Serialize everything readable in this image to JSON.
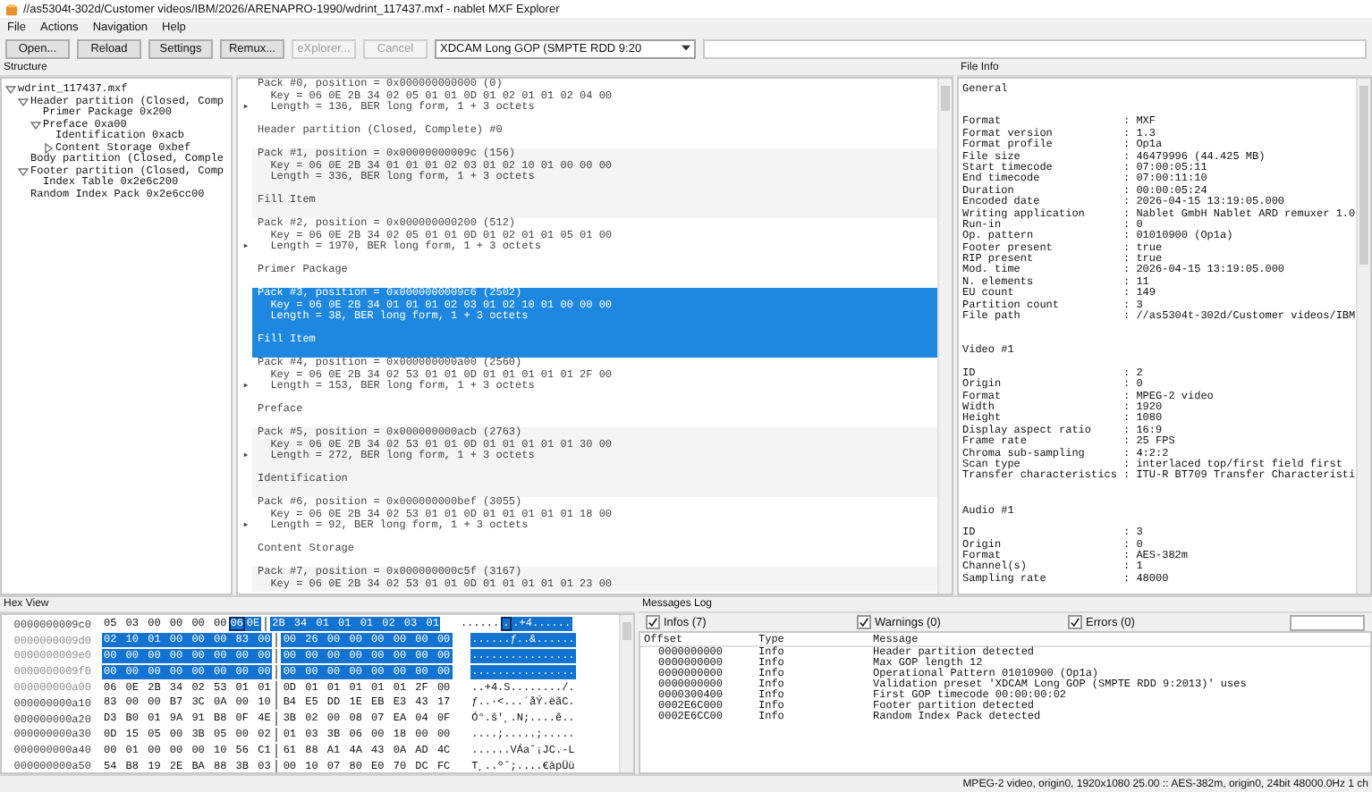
{
  "window": {
    "title": "//as5304t-302d/Customer videos/IBM/2026/ARENAPRO-1990/wdrint_117437.mxf - nablet MXF Explorer"
  },
  "menu": [
    "File",
    "Actions",
    "Navigation",
    "Help"
  ],
  "toolbar": {
    "buttons": [
      {
        "label": "Open...",
        "disabled": false
      },
      {
        "label": "Reload",
        "disabled": false
      },
      {
        "label": "Settings",
        "disabled": false
      },
      {
        "label": "Remux...",
        "disabled": false
      },
      {
        "label": "eXplorer...",
        "disabled": true
      },
      {
        "label": "Cancel",
        "disabled": true
      }
    ],
    "preset": "XDCAM Long GOP (SMPTE RDD 9:20"
  },
  "structure": {
    "title": "Structure",
    "tree": [
      {
        "label": "wdrint_117437.mxf",
        "expanded": true,
        "children": [
          {
            "label": "Header partition (Closed, Comp",
            "expanded": true,
            "children": [
              {
                "label": "Primer Package 0x200"
              },
              {
                "label": "Preface 0xa00",
                "expanded": true,
                "children": [
                  {
                    "label": "Identification 0xacb"
                  },
                  {
                    "label": "Content Storage 0xbef",
                    "expanded": false
                  }
                ]
              }
            ]
          },
          {
            "label": "Body partition (Closed, Comple"
          },
          {
            "label": "Footer partition (Closed, Comp",
            "expanded": true,
            "children": [
              {
                "label": "Index Table 0x2e6c200"
              }
            ]
          },
          {
            "label": "Random Index Pack 0x2e6cc00"
          }
        ]
      }
    ]
  },
  "packets": [
    {
      "lines": [
        "Pack #0, position = 0x000000000000 (0)",
        "  Key = 06 0E 2B 34 02 05 01 01 0D 01 02 01 01 02 04 00",
        "  Length = 136, BER long form, 1 + 3 octets"
      ],
      "name": "Header partition (Closed, Complete) #0",
      "expandable": true,
      "selected": false
    },
    {
      "lines": [
        "Pack #1, position = 0x00000000009c (156)",
        "  Key = 06 0E 2B 34 01 01 01 02 03 01 02 10 01 00 00 00",
        "  Length = 336, BER long form, 1 + 3 octets"
      ],
      "name": "Fill Item",
      "expandable": false,
      "selected": false
    },
    {
      "lines": [
        "Pack #2, position = 0x000000000200 (512)",
        "  Key = 06 0E 2B 34 02 05 01 01 0D 01 02 01 01 05 01 00",
        "  Length = 1970, BER long form, 1 + 3 octets"
      ],
      "name": "Primer Package",
      "expandable": true,
      "selected": false
    },
    {
      "lines": [
        "Pack #3, position = 0x0000000009c6 (2502)",
        "  Key = 06 0E 2B 34 01 01 01 02 03 01 02 10 01 00 00 00",
        "  Length = 38, BER long form, 1 + 3 octets"
      ],
      "name": "Fill Item",
      "expandable": false,
      "selected": true
    },
    {
      "lines": [
        "Pack #4, position = 0x000000000a00 (2560)",
        "  Key = 06 0E 2B 34 02 53 01 01 0D 01 01 01 01 01 2F 00",
        "  Length = 153, BER long form, 1 + 3 octets"
      ],
      "name": "Preface",
      "expandable": true,
      "selected": false
    },
    {
      "lines": [
        "Pack #5, position = 0x000000000acb (2763)",
        "  Key = 06 0E 2B 34 02 53 01 01 0D 01 01 01 01 01 30 00",
        "  Length = 272, BER long form, 1 + 3 octets"
      ],
      "name": "Identification",
      "expandable": true,
      "selected": false
    },
    {
      "lines": [
        "Pack #6, position = 0x000000000bef (3055)",
        "  Key = 06 0E 2B 34 02 53 01 01 0D 01 01 01 01 01 18 00",
        "  Length = 92, BER long form, 1 + 3 octets"
      ],
      "name": "Content Storage",
      "expandable": true,
      "selected": false
    },
    {
      "lines": [
        "Pack #7, position = 0x000000000c5f (3167)",
        "  Key = 06 0E 2B 34 02 53 01 01 0D 01 01 01 01 01 23 00"
      ],
      "expandable": false,
      "selected": false
    }
  ],
  "file_info": {
    "title": "File Info",
    "sections": [
      {
        "heading": "General",
        "rows": [
          {
            "key": "Format",
            "value": ": MXF"
          },
          {
            "key": "Format version",
            "value": ": 1.3"
          },
          {
            "key": "Format profile",
            "value": ": Op1a"
          },
          {
            "key": "File size",
            "value": ": 46479996 (44.425 MB)"
          },
          {
            "key": "Start timecode",
            "value": ": 07:00:05:11"
          },
          {
            "key": "End timecode",
            "value": ": 07:00:11:10"
          },
          {
            "key": "Duration",
            "value": ": 00:00:05:24"
          },
          {
            "key": "Encoded date",
            "value": ": 2026-04-15 13:19:05.000"
          },
          {
            "key": "Writing application",
            "value": ": Nablet GmbH Nablet ARD remuxer 1.0"
          },
          {
            "key": "Run-in",
            "value": ": 0"
          },
          {
            "key": "Op. pattern",
            "value": ": 01010900 (Op1a)"
          },
          {
            "key": "Footer present",
            "value": ": true"
          },
          {
            "key": "RIP present",
            "value": ": true"
          },
          {
            "key": "Mod. time",
            "value": ": 2026-04-15 13:19:05.000"
          },
          {
            "key": "N. elements",
            "value": ": 11"
          },
          {
            "key": "EU count",
            "value": ": 149"
          },
          {
            "key": "Partition count",
            "value": ": 3"
          },
          {
            "key": "File path",
            "value": ": //as5304t-302d/Customer videos/IBM"
          }
        ]
      },
      {
        "heading": "Video #1",
        "rows": [
          {
            "key": "ID",
            "value": ": 2"
          },
          {
            "key": "Origin",
            "value": ": 0"
          },
          {
            "key": "Format",
            "value": ": MPEG-2 video"
          },
          {
            "key": "Width",
            "value": ": 1920"
          },
          {
            "key": "Height",
            "value": ": 1080"
          },
          {
            "key": "Display aspect ratio",
            "value": ": 16:9"
          },
          {
            "key": "Frame rate",
            "value": ": 25 FPS"
          },
          {
            "key": "Chroma sub-sampling",
            "value": ": 4:2:2"
          },
          {
            "key": "Scan type",
            "value": ": interlaced top/first field first"
          },
          {
            "key": "Transfer characteristics",
            "value": ": ITU-R BT709 Transfer Characteristi"
          }
        ]
      },
      {
        "heading": "Audio #1",
        "rows": [
          {
            "key": "ID",
            "value": ": 3"
          },
          {
            "key": "Origin",
            "value": ": 0"
          },
          {
            "key": "Format",
            "value": ": AES-382m"
          },
          {
            "key": "Channel(s)",
            "value": ": 1"
          },
          {
            "key": "Sampling rate",
            "value": ": 48000"
          }
        ]
      }
    ]
  },
  "hex_view": {
    "title": "Hex View",
    "rows": [
      {
        "offset": "0000000009c0",
        "dim": false,
        "left": [
          {
            "text": "05 03 00 00 00 00",
            "selected": false,
            "cursor": false
          },
          {
            "text": "06",
            "selected": true,
            "cursor": true
          },
          {
            "text": "0E",
            "selected": true,
            "cursor": false
          }
        ],
        "right": [
          {
            "text": "2B 34 01 01 01 02 03 01",
            "selected": true,
            "cursor": false
          }
        ],
        "ascii": [
          {
            "text": "......",
            "selected": false,
            "cursor": false
          },
          {
            "text": ".",
            "selected": true,
            "cursor": true
          },
          {
            "text": ".+4......",
            "selected": true,
            "cursor": false
          }
        ]
      },
      {
        "offset": "0000000009d0",
        "dim": true,
        "left": [
          {
            "text": "02 10 01 00 00 00 83 00",
            "selected": true,
            "cursor": false
          }
        ],
        "right": [
          {
            "text": "00 26 00 00 00 00 00 00",
            "selected": true,
            "cursor": false
          }
        ],
        "ascii": [
          {
            "text": "......ƒ..&......",
            "selected": true,
            "cursor": false
          }
        ]
      },
      {
        "offset": "0000000009e0",
        "dim": true,
        "left": [
          {
            "text": "00 00 00 00 00 00 00 00",
            "selected": true,
            "cursor": false
          }
        ],
        "right": [
          {
            "text": "00 00 00 00 00 00 00 00",
            "selected": true,
            "cursor": false
          }
        ],
        "ascii": [
          {
            "text": "................",
            "selected": true,
            "cursor": false
          }
        ]
      },
      {
        "offset": "0000000009f0",
        "dim": true,
        "left": [
          {
            "text": "00 00 00 00 00 00 00 00",
            "selected": true,
            "cursor": false
          }
        ],
        "right": [
          {
            "text": "00 00 00 00 00 00 00 00",
            "selected": true,
            "cursor": false
          }
        ],
        "ascii": [
          {
            "text": "................",
            "selected": true,
            "cursor": false
          }
        ]
      },
      {
        "offset": "000000000a00",
        "dim": true,
        "left": [
          {
            "text": "06 0E 2B 34 02 53 01 01",
            "selected": false,
            "cursor": false
          }
        ],
        "right": [
          {
            "text": "0D 01 01 01 01 01 2F 00",
            "selected": false,
            "cursor": false
          }
        ],
        "ascii": [
          {
            "text": "..+4.S......../.",
            "selected": false,
            "cursor": false
          }
        ]
      },
      {
        "offset": "000000000a10",
        "dim": false,
        "left": [
          {
            "text": "83 00 00 B7 3C 0A 00 10",
            "selected": false,
            "cursor": false
          }
        ],
        "right": [
          {
            "text": "B4 E5 DD 1E EB E3 43 17",
            "selected": false,
            "cursor": false
          }
        ],
        "ascii": [
          {
            "text": "ƒ..·<...´åÝ.ëãC.",
            "selected": false,
            "cursor": false
          }
        ]
      },
      {
        "offset": "000000000a20",
        "dim": false,
        "left": [
          {
            "text": "D3 B0 01 9A 91 B8 0F 4E",
            "selected": false,
            "cursor": false
          }
        ],
        "right": [
          {
            "text": "3B 02 00 08 07 EA 04 0F",
            "selected": false,
            "cursor": false
          }
        ],
        "ascii": [
          {
            "text": "Ó°.š'¸.N;....ê..",
            "selected": false,
            "cursor": false
          }
        ]
      },
      {
        "offset": "000000000a30",
        "dim": false,
        "left": [
          {
            "text": "0D 15 05 00 3B 05 00 02",
            "selected": false,
            "cursor": false
          }
        ],
        "right": [
          {
            "text": "01 03 3B 06 00 18 00 00",
            "selected": false,
            "cursor": false
          }
        ],
        "ascii": [
          {
            "text": "....;.....;.....",
            "selected": false,
            "cursor": false
          }
        ]
      },
      {
        "offset": "000000000a40",
        "dim": false,
        "left": [
          {
            "text": "00 01 00 00 00 10 56 C1",
            "selected": false,
            "cursor": false
          }
        ],
        "right": [
          {
            "text": "61 88 A1 4A 43 0A AD 4C",
            "selected": false,
            "cursor": false
          }
        ],
        "ascii": [
          {
            "text": "......VÁaˆ¡JC.-L",
            "selected": false,
            "cursor": false
          }
        ]
      },
      {
        "offset": "000000000a50",
        "dim": false,
        "left": [
          {
            "text": "54 B8 19 2E BA 88 3B 03",
            "selected": false,
            "cursor": false
          }
        ],
        "right": [
          {
            "text": "00 10 07 80 E0 70 DC FC",
            "selected": false,
            "cursor": false
          }
        ],
        "ascii": [
          {
            "text": "T¸..ºˆ;....€àpÜü",
            "selected": false,
            "cursor": false
          }
        ]
      }
    ]
  },
  "messages_log": {
    "title": "Messages Log",
    "filters": [
      {
        "label": "Infos (7)",
        "checked": true
      },
      {
        "label": "Warnings (0)",
        "checked": true
      },
      {
        "label": "Errors (0)",
        "checked": true
      }
    ],
    "columns": [
      "Offset",
      "Type",
      "Message"
    ],
    "rows": [
      [
        "0000000000",
        "Info",
        "Header partition detected"
      ],
      [
        "0000000000",
        "Info",
        "Max GOP length 12"
      ],
      [
        "0000000000",
        "Info",
        "Operational Pattern 01010900 (Op1a)"
      ],
      [
        "0000000000",
        "Info",
        "Validation preset 'XDCAM Long GOP (SMPTE RDD 9:2013)' uses"
      ],
      [
        "0000300400",
        "Info",
        "First GOP timecode 00:00:00:02"
      ],
      [
        "0002E6C000",
        "Info",
        "Footer partition detected"
      ],
      [
        "0002E6CC00",
        "Info",
        "Random Index Pack detected"
      ]
    ]
  },
  "status_bar": "MPEG-2 video, origin0, 1920x1080 25.00 :: AES-382m, origin0, 24bit 48000.0Hz 1 ch"
}
